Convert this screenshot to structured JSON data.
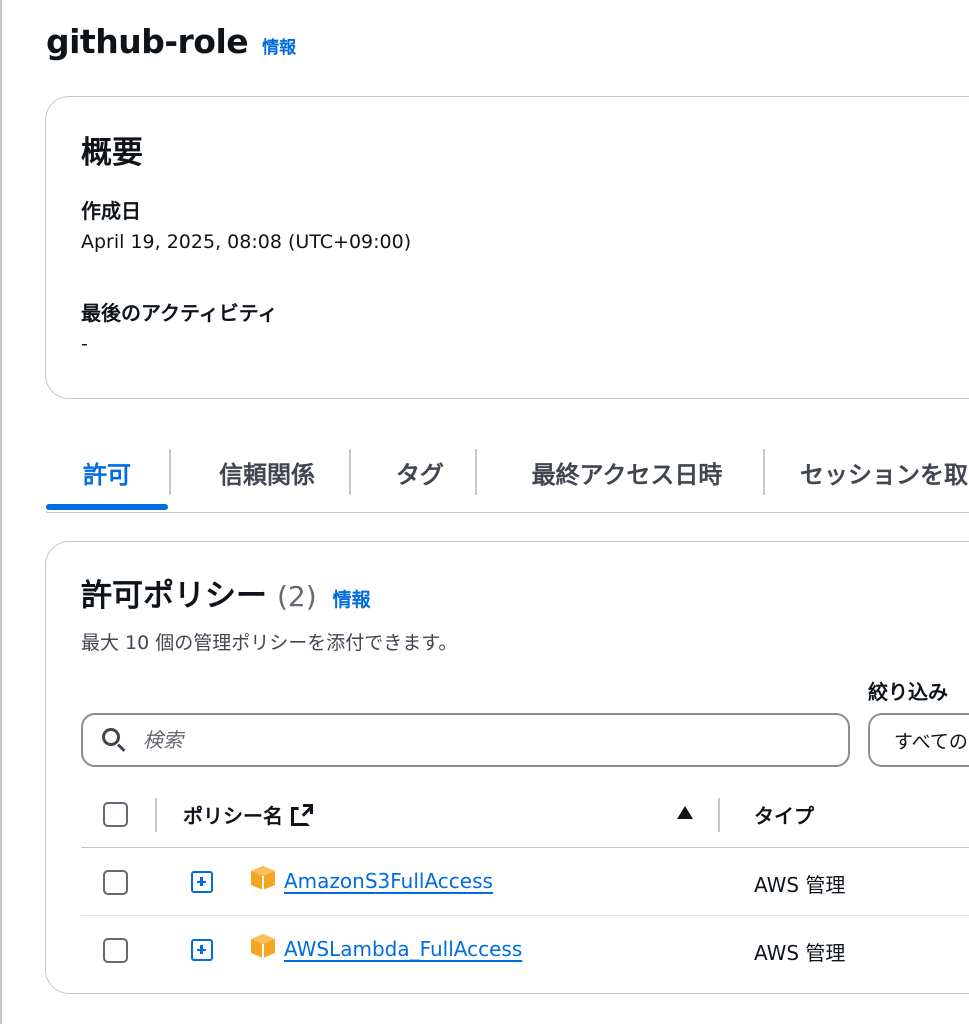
{
  "page": {
    "title": "github-role",
    "info_label": "情報"
  },
  "summary": {
    "heading": "概要",
    "created_label": "作成日",
    "created_value": "April 19, 2025, 08:08 (UTC+09:00)",
    "last_activity_label": "最後のアクティビティ",
    "last_activity_value": "-"
  },
  "tabs": [
    {
      "label": "許可",
      "active": true
    },
    {
      "label": "信頼関係",
      "active": false
    },
    {
      "label": "タグ",
      "active": false
    },
    {
      "label": "最終アクセス日時",
      "active": false
    },
    {
      "label": "セッションを取",
      "active": false
    }
  ],
  "permissions": {
    "heading": "許可ポリシー",
    "count": "(2)",
    "info_label": "情報",
    "description": "最大 10 個の管理ポリシーを添付できます。",
    "filter_label": "絞り込み",
    "search_placeholder": "検索",
    "filter_select_value": "すべての",
    "columns": {
      "policy_name": "ポリシー名",
      "type": "タイプ"
    },
    "rows": [
      {
        "name": "AmazonS3FullAccess",
        "type": "AWS 管理"
      },
      {
        "name": "AWSLambda_FullAccess",
        "type": "AWS 管理"
      }
    ]
  },
  "colors": {
    "accent": "#006ce0",
    "text": "#0f141a",
    "border": "#c6c6cd",
    "policy_icon": "#f5a623"
  },
  "icons": {
    "search": "search-icon",
    "external_link": "external-link-icon",
    "sort": "sort-ascending-icon",
    "expand": "expand-plus-icon",
    "policy": "aws-managed-policy-icon"
  }
}
